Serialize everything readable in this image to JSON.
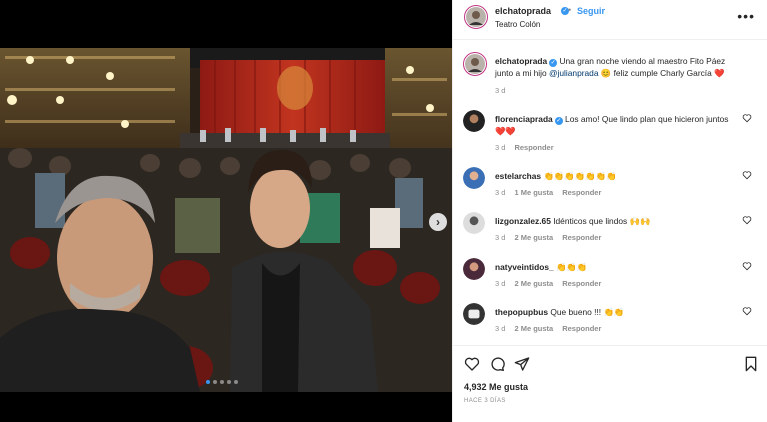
{
  "post": {
    "username": "elchatoprada",
    "follow_label": "Seguir",
    "separator": "•",
    "location": "Teatro Colón",
    "more_label": "•••"
  },
  "caption": {
    "username": "elchatoprada",
    "text_part1": "Una gran noche viendo al maestro Fito Páez junto a mi hijo",
    "mention": "@julianprada",
    "text_part2": "😊 feliz cumple Charly García ❤️",
    "time": "3 d"
  },
  "comments": [
    {
      "username": "florenciaprada",
      "verified": true,
      "text": "Los amo! Que lindo plan que hicieron juntos ❤️❤️",
      "time": "3 d",
      "likes": "",
      "reply": "Responder"
    },
    {
      "username": "estelarchas",
      "verified": false,
      "text": "👏👏👏👏👏👏👏",
      "time": "3 d",
      "likes": "1 Me gusta",
      "reply": "Responder"
    },
    {
      "username": "lizgonzalez.65",
      "verified": false,
      "text": "Idénticos que lindos 🙌🙌",
      "time": "3 d",
      "likes": "2 Me gusta",
      "reply": "Responder"
    },
    {
      "username": "natyveintidos_",
      "verified": false,
      "text": "👏👏👏",
      "time": "3 d",
      "likes": "2 Me gusta",
      "reply": "Responder"
    },
    {
      "username": "thepopupbus",
      "verified": false,
      "text": "Que bueno !!! 👏👏",
      "time": "3 d",
      "likes": "2 Me gusta",
      "reply": "Responder"
    }
  ],
  "footer": {
    "likes": "4,932 Me gusta",
    "ago": "HACE 3 DÍAS"
  },
  "icons": {
    "like": "heart-icon",
    "comment": "comment-icon",
    "share": "share-icon",
    "save": "bookmark-icon",
    "carousel_next": "chevron-right-icon"
  },
  "colors": {
    "link_blue": "#3897f0",
    "heart_red": "#ed4956",
    "meta_gray": "#8e8e8e"
  }
}
